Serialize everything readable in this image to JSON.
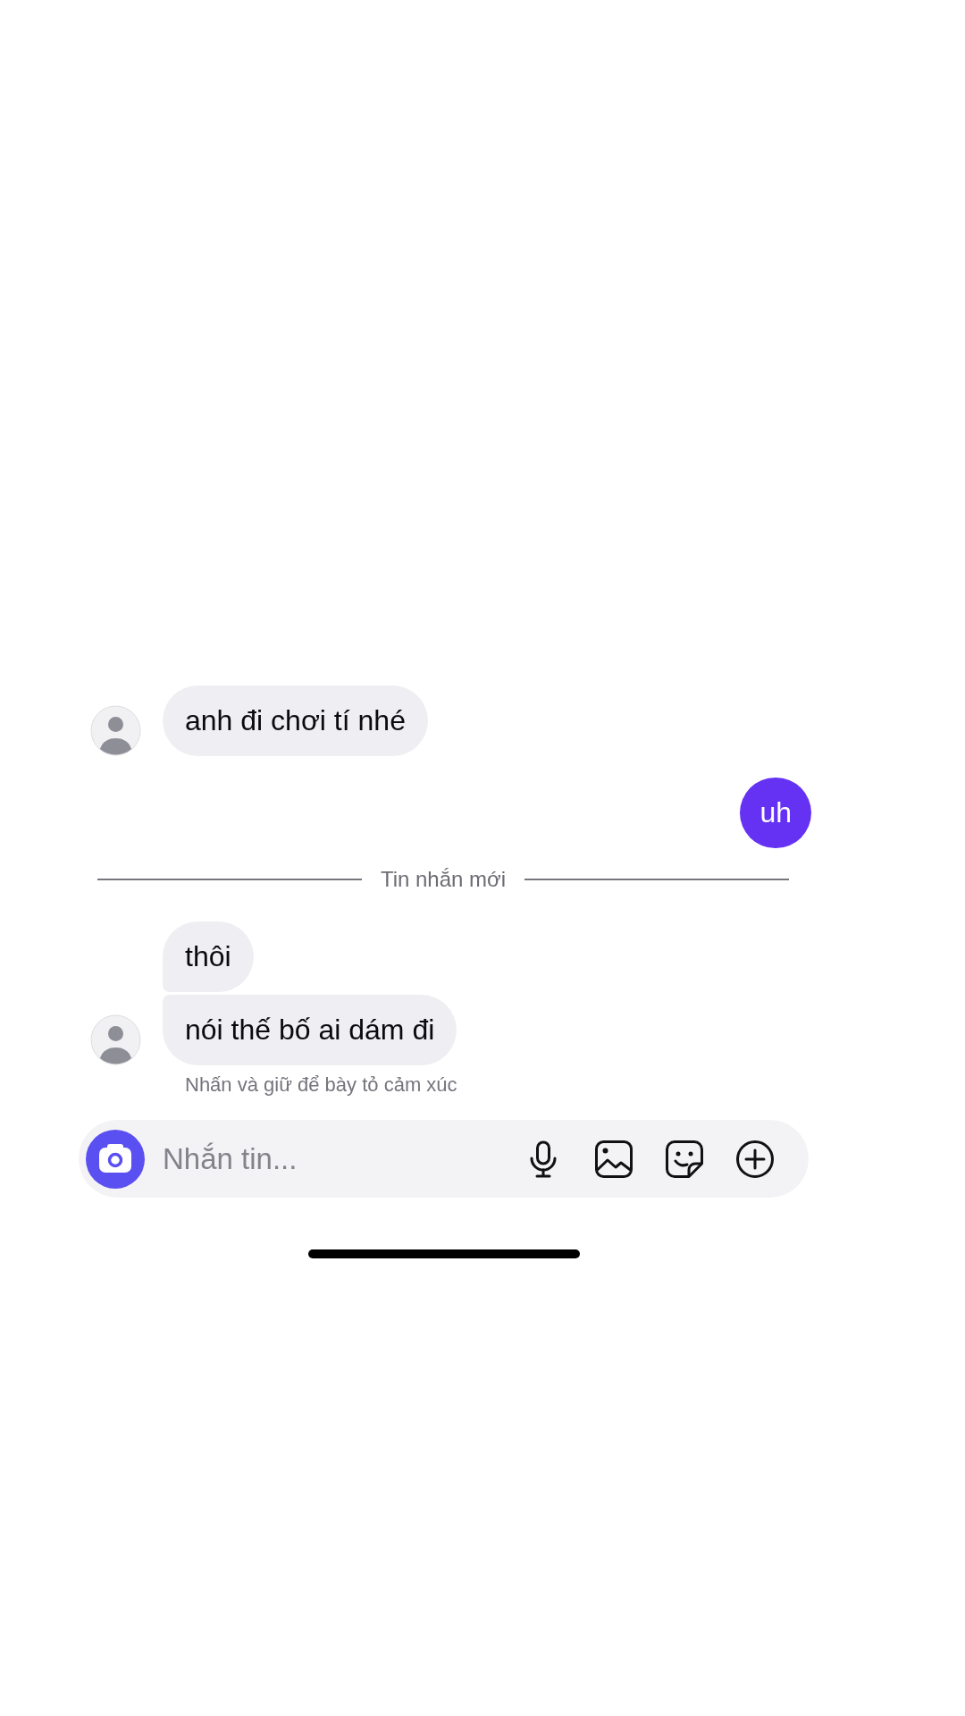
{
  "messages": [
    {
      "kind": "received",
      "text": "anh đi chơi tí nhé",
      "avatar": true
    },
    {
      "kind": "sent",
      "text": "uh"
    },
    {
      "kind": "divider",
      "text": "Tin nhắn mới"
    },
    {
      "kind": "received",
      "text": "thôi",
      "avatar": false
    },
    {
      "kind": "received",
      "text": "nói thế bố ai dám đi",
      "avatar": true
    }
  ],
  "reaction_hint": "Nhấn và giữ để bày tỏ cảm xúc",
  "composer": {
    "placeholder": "Nhắn tin..."
  }
}
